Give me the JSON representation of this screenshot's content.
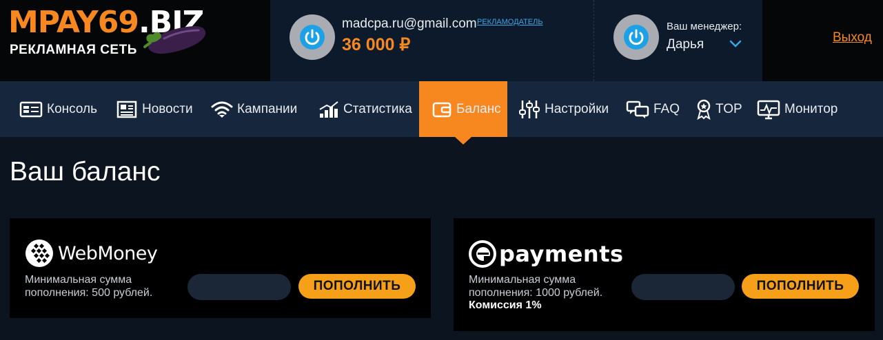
{
  "logo": {
    "main_orange": "MPAY69",
    "main_white": ".BIZ",
    "subtitle": "РЕКЛАМНАЯ СЕТЬ",
    "icon": "eggplant-icon"
  },
  "account": {
    "email": "madcpa.ru@gmail.com",
    "role": "РЕКЛАМОДАТЕЛЬ",
    "balance": "36 000 ₽",
    "avatar_icon": "power-icon"
  },
  "manager": {
    "label": "Ваш менеджер:",
    "name": "Дарья",
    "dropdown_icon": "chevron-down-icon"
  },
  "logout": "Выход",
  "nav": {
    "items": [
      {
        "label": "Консоль",
        "icon": "console-icon"
      },
      {
        "label": "Новости",
        "icon": "news-icon"
      },
      {
        "label": "Кампании",
        "icon": "wifi-icon"
      },
      {
        "label": "Статистика",
        "icon": "chart-icon"
      },
      {
        "label": "Баланс",
        "icon": "wallet-icon",
        "active": true
      },
      {
        "label": "Настройки",
        "icon": "sliders-icon"
      },
      {
        "label": "FAQ",
        "icon": "chat-icon"
      },
      {
        "label": "TOP",
        "icon": "award-icon"
      },
      {
        "label": "Монитор",
        "icon": "monitor-icon"
      }
    ]
  },
  "page": {
    "title": "Ваш баланс"
  },
  "payments": [
    {
      "name": "WebMoney",
      "description": "Минимальная сумма пополнения: 500 рублей.",
      "fee": "",
      "amount_value": "",
      "button": "ПОПОЛНИТЬ"
    },
    {
      "name": "payments",
      "description": "Минимальная сумма пополнения: 1000 рублей.",
      "fee": "Комиссия 1%",
      "amount_value": "",
      "button": "ПОПОЛНИТЬ"
    }
  ],
  "colors": {
    "accent": "#f6881f",
    "button": "#f6a01a",
    "nav_bg": "#16263c",
    "page_bg": "#0c1420",
    "link_blue": "#3aa7e6"
  }
}
